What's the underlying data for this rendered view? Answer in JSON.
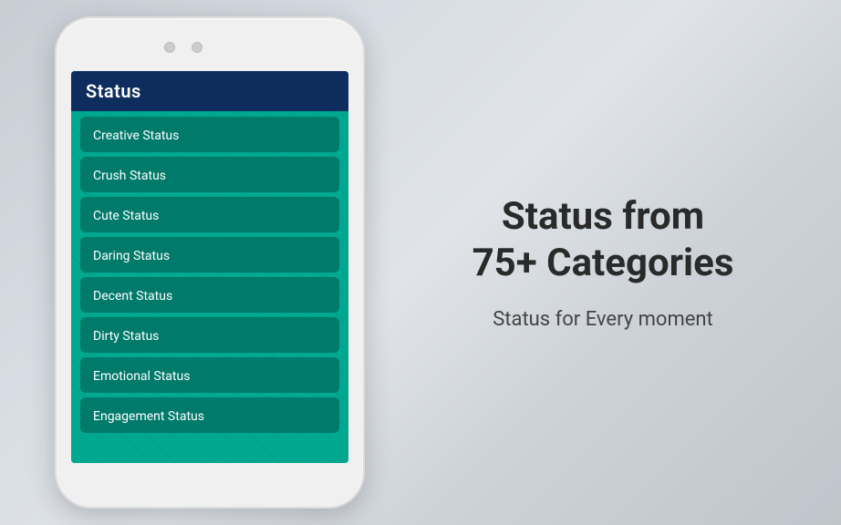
{
  "phone": {
    "header": {
      "title": "Status"
    },
    "list_items": [
      {
        "id": "creative-status",
        "label": "Creative Status"
      },
      {
        "id": "crush-status",
        "label": "Crush Status"
      },
      {
        "id": "cute-status",
        "label": "Cute Status"
      },
      {
        "id": "daring-status",
        "label": "Daring Status"
      },
      {
        "id": "decent-status",
        "label": "Decent Status"
      },
      {
        "id": "dirty-status",
        "label": "Dirty Status"
      },
      {
        "id": "emotional-status",
        "label": "Emotional Status"
      },
      {
        "id": "engagement-status",
        "label": "Engagement Status"
      }
    ]
  },
  "right": {
    "headline": "Status from\n75+ Categories",
    "subheadline": "Status for Every moment"
  }
}
